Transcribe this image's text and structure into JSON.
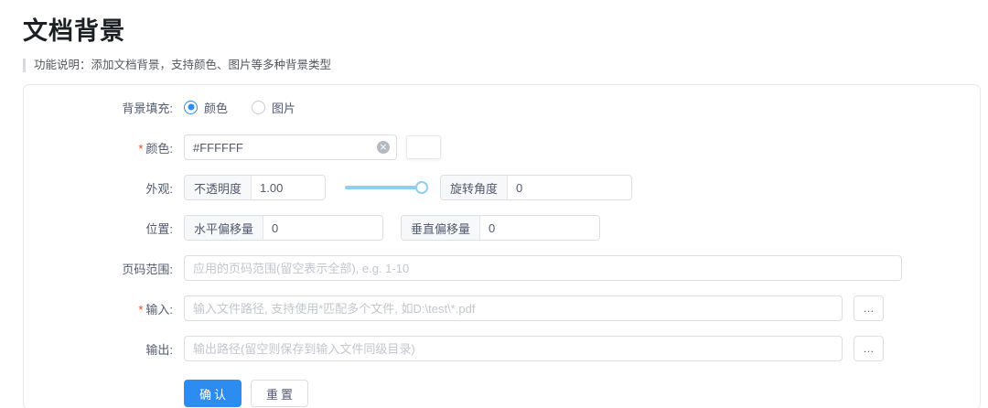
{
  "page": {
    "title": "文档背景",
    "description": "功能说明：添加文档背景，支持颜色、图片等多种背景类型"
  },
  "form": {
    "required_mark": "*",
    "background_fill": {
      "label": "背景填充:",
      "options": [
        {
          "label": "颜色",
          "selected": true
        },
        {
          "label": "图片",
          "selected": false
        }
      ]
    },
    "color": {
      "label": "颜色:",
      "required": true,
      "value": "#FFFFFF",
      "swatch_color": "#FFFFFF",
      "clear_icon": "×"
    },
    "appearance": {
      "label": "外观:",
      "opacity": {
        "label": "不透明度",
        "value": "1.00",
        "slider_percent": 100
      },
      "rotation": {
        "label": "旋转角度",
        "value": "0"
      }
    },
    "position": {
      "label": "位置:",
      "horizontal": {
        "label": "水平偏移量",
        "value": "0"
      },
      "vertical": {
        "label": "垂直偏移量",
        "value": "0"
      }
    },
    "page_range": {
      "label": "页码范围:",
      "placeholder": "应用的页码范围(留空表示全部), e.g. 1-10"
    },
    "input_file": {
      "label": "输入:",
      "required": true,
      "placeholder": "输入文件路径, 支持使用*匹配多个文件, 如D:\\test\\*.pdf",
      "browse_label": "…"
    },
    "output_file": {
      "label": "输出:",
      "placeholder": "输出路径(留空则保存到输入文件同级目录)",
      "browse_label": "…"
    },
    "actions": {
      "confirm": "确认",
      "reset": "重置"
    }
  },
  "colors": {
    "primary": "#2d8cf0",
    "slider_track": "#8fcdf1",
    "required_asterisk": "#ed4014",
    "swatch": "#FFFFFF"
  }
}
